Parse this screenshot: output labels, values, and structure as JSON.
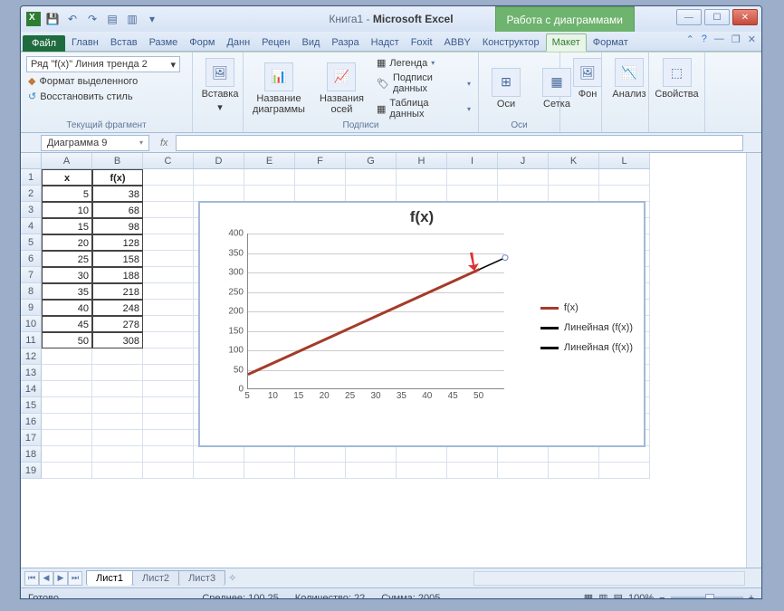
{
  "title": {
    "doc": "Книга1",
    "app": "Microsoft Excel",
    "tools": "Работа с диаграммами"
  },
  "qat_icons": [
    "save",
    "undo",
    "redo",
    "print",
    "new"
  ],
  "tabs": {
    "file": "Файл",
    "items": [
      "Главн",
      "Встав",
      "Разме",
      "Форм",
      "Данн",
      "Рецен",
      "Вид",
      "Разра",
      "Надст",
      "Foxit",
      "ABBY"
    ],
    "chart": [
      "Конструктор",
      "Макет",
      "Формат"
    ],
    "active": "Макет"
  },
  "ribbon": {
    "frag": {
      "combo": "Ряд \"f(x)\" Линия тренда 2",
      "format_sel": "Формат выделенного",
      "reset": "Восстановить стиль",
      "label": "Текущий фрагмент"
    },
    "insert": {
      "btn": "Вставка",
      "label": ""
    },
    "labels": {
      "chart_title": "Название\nдиаграммы",
      "axis_title": "Названия\nосей",
      "legend": "Легенда",
      "data_labels": "Подписи данных",
      "data_table": "Таблица данных",
      "label": "Подписи"
    },
    "axes": {
      "axes": "Оси",
      "grid": "Сетка",
      "label": "Оси"
    },
    "bg": "Фон",
    "analysis": "Анализ",
    "props": "Свойства"
  },
  "namebox": "Диаграмма 9",
  "fx": "fx",
  "columns": [
    "A",
    "B",
    "C",
    "D",
    "E",
    "F",
    "G",
    "H",
    "I",
    "J",
    "K",
    "L"
  ],
  "rows": 19,
  "table": {
    "headers": [
      "x",
      "f(x)"
    ],
    "data": [
      [
        5,
        38
      ],
      [
        10,
        68
      ],
      [
        15,
        98
      ],
      [
        20,
        128
      ],
      [
        25,
        158
      ],
      [
        30,
        188
      ],
      [
        35,
        218
      ],
      [
        40,
        248
      ],
      [
        45,
        278
      ],
      [
        50,
        308
      ]
    ]
  },
  "chart_data": {
    "type": "line",
    "title": "f(x)",
    "x": [
      5,
      10,
      15,
      20,
      25,
      30,
      35,
      40,
      45,
      50
    ],
    "series": [
      {
        "name": "f(x)",
        "values": [
          38,
          68,
          98,
          128,
          158,
          188,
          218,
          248,
          278,
          308
        ],
        "color": "#a63a2a",
        "width": 3
      },
      {
        "name": "Линейная (f(x))",
        "values": [
          38,
          338
        ],
        "x": [
          5,
          55
        ],
        "color": "#000",
        "width": 1
      },
      {
        "name": "Линейная (f(x))",
        "values": [
          38,
          338
        ],
        "x": [
          5,
          55
        ],
        "color": "#000",
        "width": 1
      }
    ],
    "xlabel": "",
    "ylabel": "",
    "xlim": [
      5,
      55
    ],
    "ylim": [
      0,
      400
    ],
    "yticks": [
      0,
      50,
      100,
      150,
      200,
      250,
      300,
      350,
      400
    ],
    "xticks": [
      5,
      10,
      15,
      20,
      25,
      30,
      35,
      40,
      45,
      50
    ],
    "legend_pos": "right",
    "grid": "horizontal"
  },
  "sheets": [
    "Лист1",
    "Лист2",
    "Лист3"
  ],
  "status": {
    "ready": "Готово",
    "avg_lbl": "Среднее:",
    "avg": "100,25",
    "cnt_lbl": "Количество:",
    "cnt": "22",
    "sum_lbl": "Сумма:",
    "sum": "2005",
    "zoom": "100%"
  }
}
